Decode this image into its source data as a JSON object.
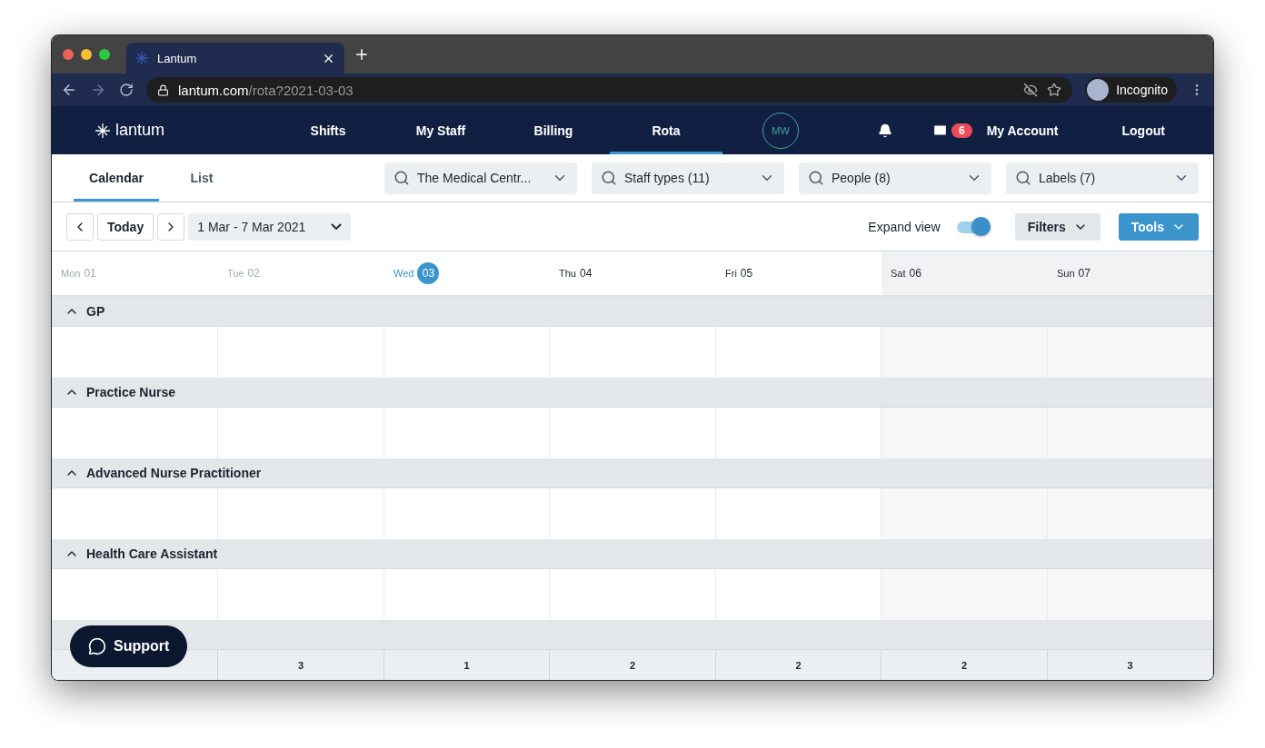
{
  "browser": {
    "tab_title": "Lantum",
    "url_host": "lantum.com",
    "url_path": "/rota?2021-03-03",
    "profile": "Incognito"
  },
  "nav": {
    "brand": "lantum",
    "items": [
      {
        "label": "Shifts",
        "selected": false
      },
      {
        "label": "My Staff",
        "selected": false
      },
      {
        "label": "Billing",
        "selected": false
      },
      {
        "label": "Rota",
        "selected": true
      }
    ],
    "avatar": "MW",
    "mail_count": "6",
    "account": "My Account",
    "logout": "Logout"
  },
  "view_tabs": [
    {
      "label": "Calendar",
      "selected": true
    },
    {
      "label": "List",
      "selected": false
    }
  ],
  "filters": [
    {
      "label": "The Medical Centr..."
    },
    {
      "label": "Staff types (11)"
    },
    {
      "label": "People (8)"
    },
    {
      "label": "Labels (7)"
    }
  ],
  "toolbar": {
    "today": "Today",
    "range": "1 Mar - 7 Mar 2021",
    "expand_label": "Expand view",
    "expand_on": true,
    "filters": "Filters",
    "tools": "Tools"
  },
  "days": [
    {
      "name": "Mon",
      "date": "01",
      "past": true,
      "today": false,
      "weekend": false
    },
    {
      "name": "Tue",
      "date": "02",
      "past": true,
      "today": false,
      "weekend": false
    },
    {
      "name": "Wed",
      "date": "03",
      "past": false,
      "today": true,
      "weekend": false
    },
    {
      "name": "Thu",
      "date": "04",
      "past": false,
      "today": false,
      "weekend": false
    },
    {
      "name": "Fri",
      "date": "05",
      "past": false,
      "today": false,
      "weekend": false
    },
    {
      "name": "Sat",
      "date": "06",
      "past": false,
      "today": false,
      "weekend": true
    },
    {
      "name": "Sun",
      "date": "07",
      "past": false,
      "today": false,
      "weekend": true
    }
  ],
  "groups": [
    {
      "label": "GP",
      "expanded": true
    },
    {
      "label": "Practice Nurse",
      "expanded": true
    },
    {
      "label": "Advanced Nurse Practitioner",
      "expanded": true
    },
    {
      "label": "Health Care Assistant",
      "expanded": true
    }
  ],
  "totals": [
    "3",
    "1",
    "2",
    "2",
    "2",
    "3"
  ],
  "support": "Support"
}
